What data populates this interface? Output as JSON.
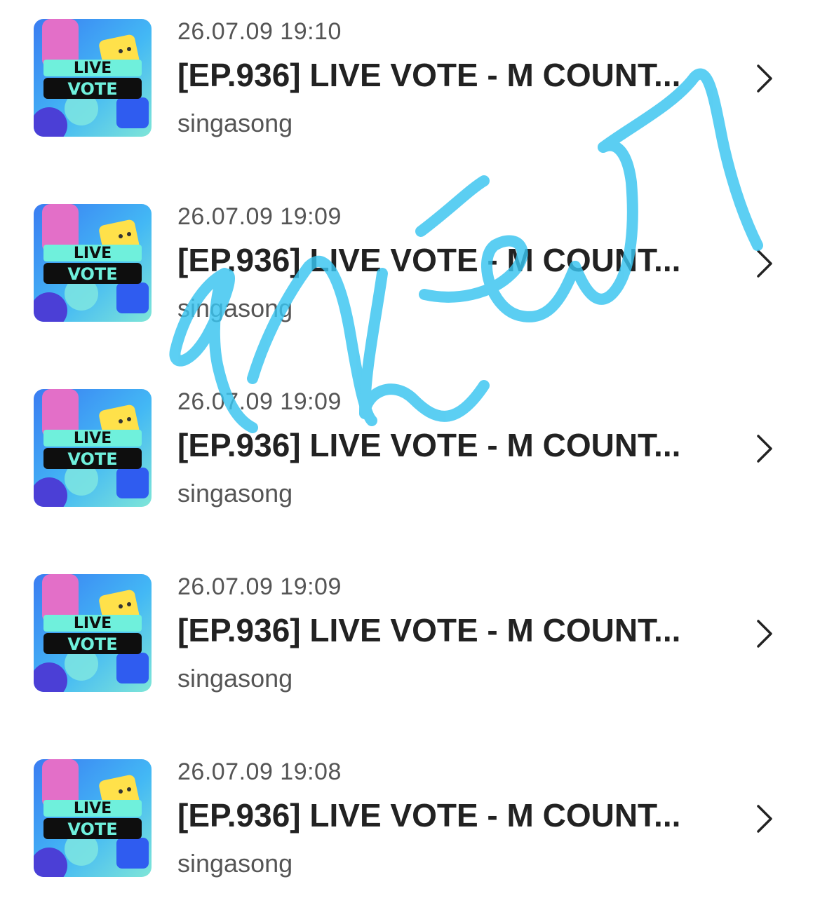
{
  "items": [
    {
      "date": "26.07.09 19:10",
      "title": "[EP.936] LIVE VOTE - M COUNT...",
      "artist": "singasong",
      "thumb_top_label": "LIVE",
      "thumb_bottom_label": "VOTE",
      "chevron_icon": "chevron-right-icon"
    },
    {
      "date": "26.07.09 19:09",
      "title": "[EP.936] LIVE VOTE - M COUNT...",
      "artist": "singasong",
      "thumb_top_label": "LIVE",
      "thumb_bottom_label": "VOTE",
      "chevron_icon": "chevron-right-icon"
    },
    {
      "date": "26.07.09 19:09",
      "title": "[EP.936] LIVE VOTE - M COUNT...",
      "artist": "singasong",
      "thumb_top_label": "LIVE",
      "thumb_bottom_label": "VOTE",
      "chevron_icon": "chevron-right-icon"
    },
    {
      "date": "26.07.09 19:09",
      "title": "[EP.936] LIVE VOTE - M COUNT...",
      "artist": "singasong",
      "thumb_top_label": "LIVE",
      "thumb_bottom_label": "VOTE",
      "chevron_icon": "chevron-right-icon"
    },
    {
      "date": "26.07.09 19:08",
      "title": "[EP.936] LIVE VOTE - M COUNT...",
      "artist": "singasong",
      "thumb_top_label": "LIVE",
      "thumb_bottom_label": "VOTE",
      "chevron_icon": "chevron-right-icon"
    }
  ],
  "colors": {
    "scribble": "#38c4f0",
    "title": "#222222",
    "meta": "#555555"
  },
  "overlay": {
    "type": "handwritten-scribble",
    "icon": "scribble-overlay"
  }
}
